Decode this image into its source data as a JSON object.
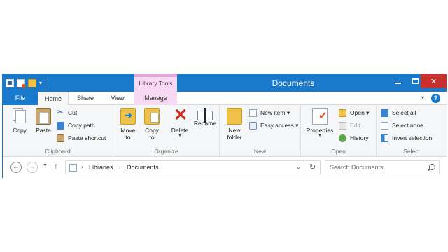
{
  "window": {
    "title": "Documents"
  },
  "contextual_tab": {
    "label": "Library Tools"
  },
  "tabs": {
    "file": "File",
    "home": "Home",
    "share": "Share",
    "view": "View",
    "manage": "Manage"
  },
  "help": {
    "label": "?"
  },
  "clipboard": {
    "group_label": "Clipboard",
    "copy": "Copy",
    "paste": "Paste",
    "cut": "Cut",
    "copy_path": "Copy path",
    "paste_shortcut": "Paste shortcut"
  },
  "organize": {
    "group_label": "Organize",
    "move_to": [
      "Move",
      "to"
    ],
    "copy_to": [
      "Copy",
      "to"
    ],
    "delete": "Delete",
    "rename": "Rename"
  },
  "new": {
    "group_label": "New",
    "new_folder": [
      "New",
      "folder"
    ],
    "new_item": "New item",
    "easy_access": "Easy access"
  },
  "open": {
    "group_label": "Open",
    "properties": "Properties",
    "open": "Open",
    "edit": "Edit",
    "history": "History"
  },
  "select": {
    "group_label": "Select",
    "select_all": "Select all",
    "select_none": "Select none",
    "invert_selection": "Invert selection"
  },
  "address": {
    "crumbs": [
      "Libraries",
      "Documents"
    ]
  },
  "search": {
    "placeholder": "Search Documents"
  },
  "colors": {
    "accent": "#1979ca",
    "close": "#c7302b",
    "library_tools": "#f7d9f3"
  }
}
